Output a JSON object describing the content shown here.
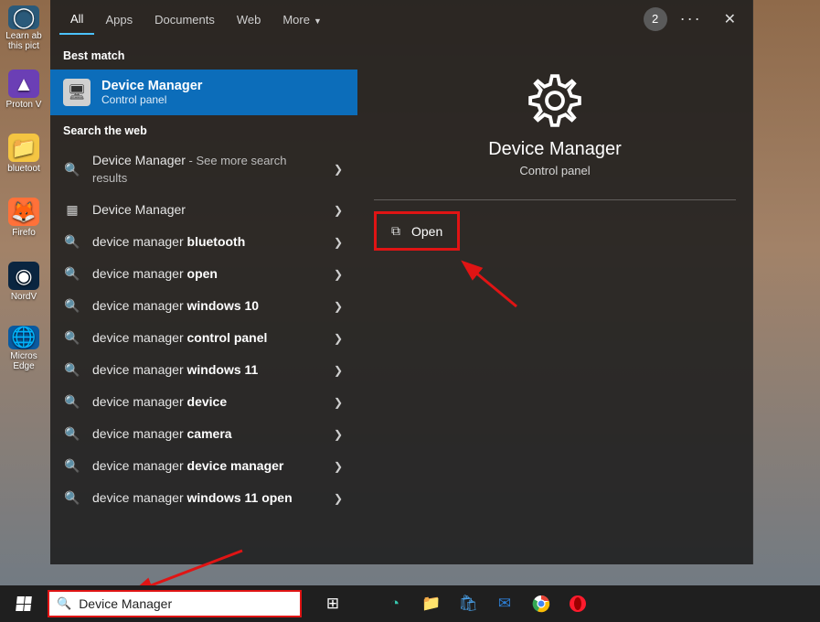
{
  "tabs": {
    "all": "All",
    "apps": "Apps",
    "documents": "Documents",
    "web": "Web",
    "more": "More",
    "badge": "2"
  },
  "sections": {
    "best_match": "Best match",
    "search_web": "Search the web"
  },
  "best_match": {
    "title": "Device Manager",
    "subtitle": "Control panel"
  },
  "web_results": [
    {
      "prefix": "Device Manager",
      "bold": "",
      "hint": " - See more search results",
      "icon": "search"
    },
    {
      "prefix": "Device Manager",
      "bold": "",
      "hint": "",
      "icon": "app"
    },
    {
      "prefix": "device manager ",
      "bold": "bluetooth",
      "hint": "",
      "icon": "search"
    },
    {
      "prefix": "device manager ",
      "bold": "open",
      "hint": "",
      "icon": "search"
    },
    {
      "prefix": "device manager ",
      "bold": "windows 10",
      "hint": "",
      "icon": "search"
    },
    {
      "prefix": "device manager ",
      "bold": "control panel",
      "hint": "",
      "icon": "search"
    },
    {
      "prefix": "device manager ",
      "bold": "windows 11",
      "hint": "",
      "icon": "search"
    },
    {
      "prefix": "device manager ",
      "bold": "device",
      "hint": "",
      "icon": "search"
    },
    {
      "prefix": "device manager ",
      "bold": "camera",
      "hint": "",
      "icon": "search"
    },
    {
      "prefix": "device manager ",
      "bold": "device manager",
      "hint": "",
      "icon": "search"
    },
    {
      "prefix": "device manager ",
      "bold": "windows 11 open",
      "hint": "",
      "icon": "search"
    }
  ],
  "preview": {
    "title": "Device Manager",
    "subtitle": "Control panel",
    "action_open": "Open"
  },
  "search_query": "Device Manager",
  "desktop_icons": [
    {
      "label": "Learn ab\nthis pict",
      "color": "#2a5a7a",
      "glyph": "◯"
    },
    {
      "label": "Proton V",
      "color": "#6b3fb5",
      "glyph": "▲"
    },
    {
      "label": "bluetoot",
      "color": "#f4c542",
      "glyph": "📁"
    },
    {
      "label": "Firefo",
      "color": "#ff7139",
      "glyph": "🦊"
    },
    {
      "label": "NordV",
      "color": "#0a2540",
      "glyph": "◉"
    },
    {
      "label": "Micros\nEdge",
      "color": "#0a5aa0",
      "glyph": "🌐"
    }
  ],
  "taskbar": {
    "icons": [
      "task-view",
      "edge",
      "file-explorer",
      "store",
      "mail",
      "chrome",
      "opera"
    ]
  }
}
